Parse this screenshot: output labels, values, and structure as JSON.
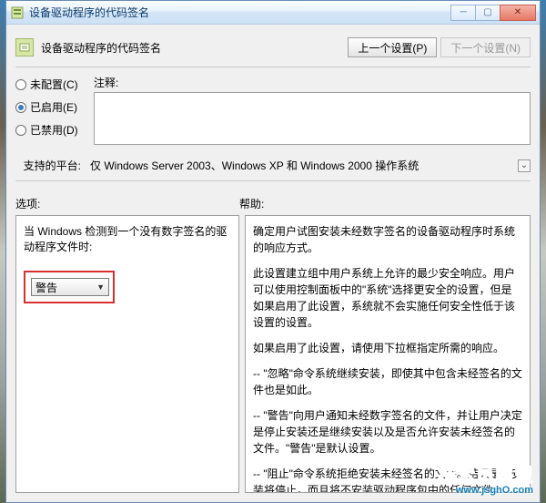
{
  "window": {
    "title": "设备驱动程序的代码签名",
    "header": "设备驱动程序的代码签名",
    "prev_btn": "上一个设置(P)",
    "next_btn": "下一个设置(N)"
  },
  "radios": {
    "not_configured": "未配置(C)",
    "enabled": "已启用(E)",
    "disabled": "已禁用(D)",
    "selected": "enabled"
  },
  "comment": {
    "label": "注释:",
    "value": ""
  },
  "platform": {
    "label": "支持的平台:",
    "value": "仅 Windows Server 2003、Windows XP 和 Windows 2000 操作系统"
  },
  "section": {
    "options_label": "选项:",
    "help_label": "帮助:"
  },
  "options": {
    "prompt": "当 Windows 检测到一个没有数字签名的驱动程序文件时:",
    "dropdown_value": "警告"
  },
  "help": {
    "p1": "确定用户试图安装未经数字签名的设备驱动程序时系统的响应方式。",
    "p2": "此设置建立组中用户系统上允许的最少安全响应。用户可以使用控制面板中的\"系统\"选择更安全的设置，但是如果启用了此设置，系统就不会实施任何安全性低于该设置的设置。",
    "p3": "如果启用了此设置，请使用下拉框指定所需的响应。",
    "p4": "-- \"忽略\"命令系统继续安装，即使其中包含未经签名的文件也是如此。",
    "p5": "-- \"警告\"向用户通知未经数字签名的文件，并让用户决定是停止安装还是继续安装以及是否允许安装未经签名的文件。\"警告\"是默认设置。",
    "p6": "-- \"阻止\"命令系统拒绝安装未经签名的文件。结果是，安装将停止，而且将不安装驱动程序包中的任何文件。"
  },
  "watermark": {
    "main": "技术员联盟",
    "sub": "www.jsghO.com"
  }
}
